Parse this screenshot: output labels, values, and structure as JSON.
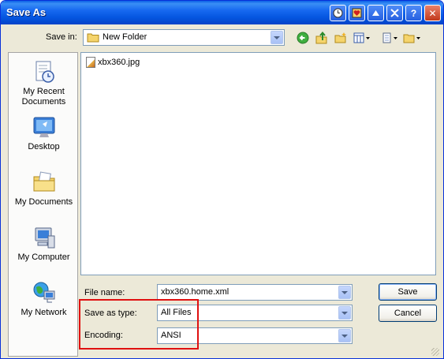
{
  "window": {
    "title": "Save As"
  },
  "titlebar_buttons": [
    "clock-icon",
    "heart-icon",
    "roll-up-icon",
    "maximize-icon",
    "help-icon",
    "close-icon"
  ],
  "toolbar": {
    "save_in_label": "Save in:",
    "location": "New Folder"
  },
  "places": [
    {
      "label": "My Recent Documents",
      "icon": "recent-documents-icon"
    },
    {
      "label": "Desktop",
      "icon": "desktop-icon"
    },
    {
      "label": "My Documents",
      "icon": "my-documents-icon"
    },
    {
      "label": "My Computer",
      "icon": "my-computer-icon"
    },
    {
      "label": "My Network",
      "icon": "my-network-icon"
    }
  ],
  "files": [
    {
      "name": "xbx360.jpg"
    }
  ],
  "form": {
    "file_name_label": "File name:",
    "file_name_value": "xbx360.home.xml",
    "save_as_type_label": "Save as type:",
    "save_as_type_value": "All Files",
    "encoding_label": "Encoding:",
    "encoding_value": "ANSI"
  },
  "buttons": {
    "save": "Save",
    "cancel": "Cancel"
  },
  "colors": {
    "titlebar": "#0556e0",
    "dialog_bg": "#ece9d8",
    "highlight_box": "#e01010"
  }
}
